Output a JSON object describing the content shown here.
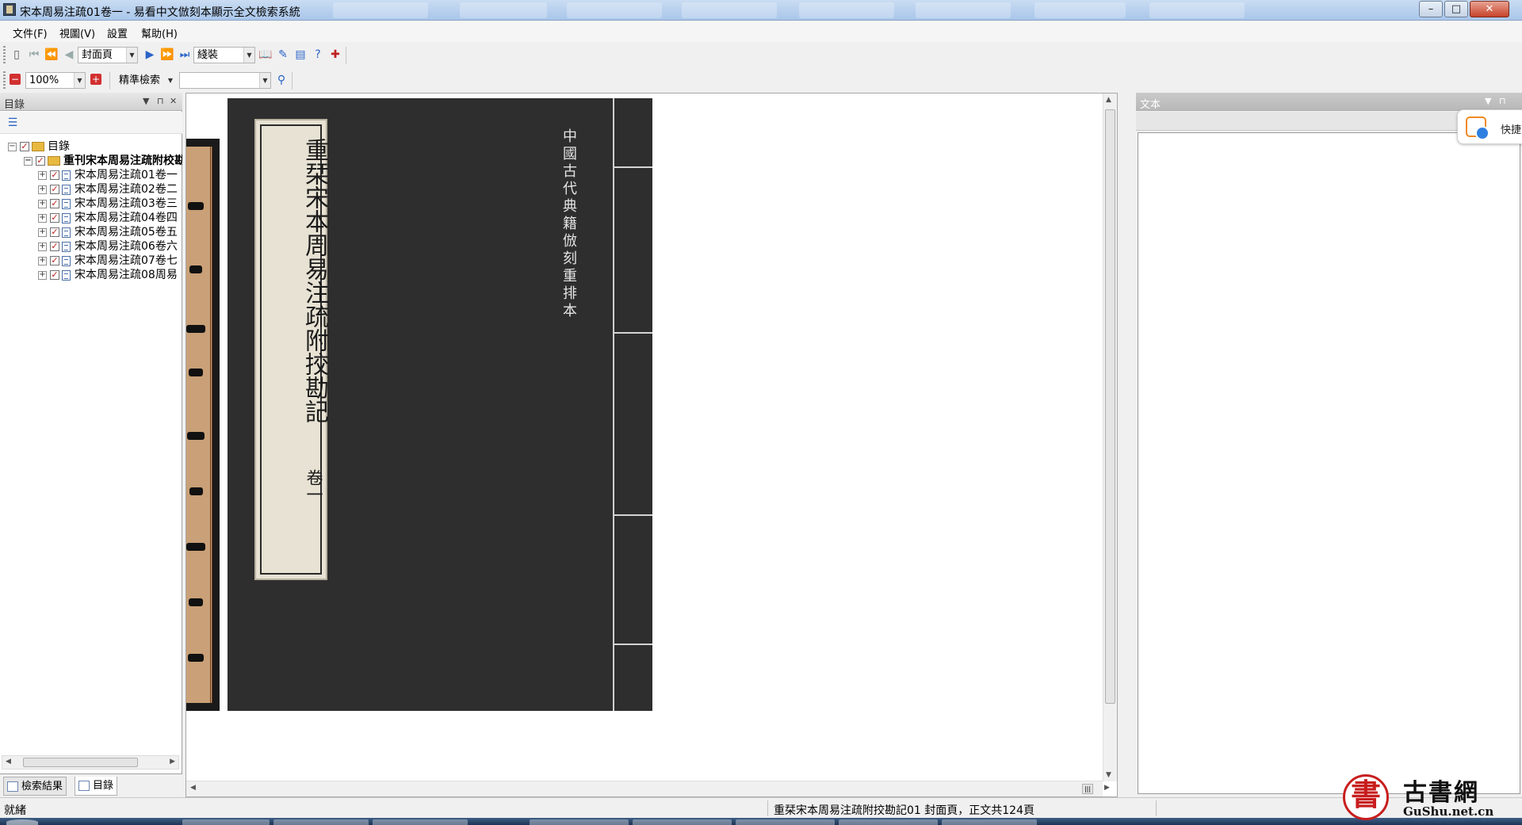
{
  "window": {
    "title": "宋本周易注疏01卷一 - 易看中文倣刻本顯示全文檢索系統",
    "buttons": {
      "minimize": "–",
      "maximize": "□",
      "close": "✕"
    }
  },
  "menu": [
    "文件(F)",
    "視圖(V)",
    "設置",
    "幫助(H)"
  ],
  "toolbar1": {
    "page_select": "封面頁",
    "binding_select": "綫裝"
  },
  "toolbar2": {
    "zoom": "100%",
    "search_mode": "精準檢索",
    "search_value": ""
  },
  "left_panel": {
    "title": "目錄",
    "tree": {
      "root": "目錄",
      "book": "重刊宋本周易注疏附校勘記",
      "volumes": [
        "宋本周易注疏01卷一",
        "宋本周易注疏02卷二",
        "宋本周易注疏03卷三",
        "宋本周易注疏04卷四",
        "宋本周易注疏05卷五",
        "宋本周易注疏06卷六",
        "宋本周易注疏07卷七",
        "宋本周易注疏08周易"
      ]
    },
    "tabs": [
      "檢索結果",
      "目錄"
    ]
  },
  "viewer": {
    "cover_title": "重栞宋本周易注疏附挍勘記",
    "cover_volume": "卷一",
    "cover_series": "中國古代典籍倣刻重排本"
  },
  "right_panel": {
    "title": "文本",
    "quick_label": "快捷"
  },
  "status": {
    "ready": "就緒",
    "info": "重栞宋本周易注疏附挍勘記01 封面頁，正文共124頁"
  },
  "watermark": {
    "seal": "書",
    "title": "古書網",
    "url": "GuShu.net.cn"
  },
  "colors": {
    "cover": "#2e2e2e",
    "label_paper": "#e7e2d3",
    "seal_red": "#c81e1e"
  }
}
